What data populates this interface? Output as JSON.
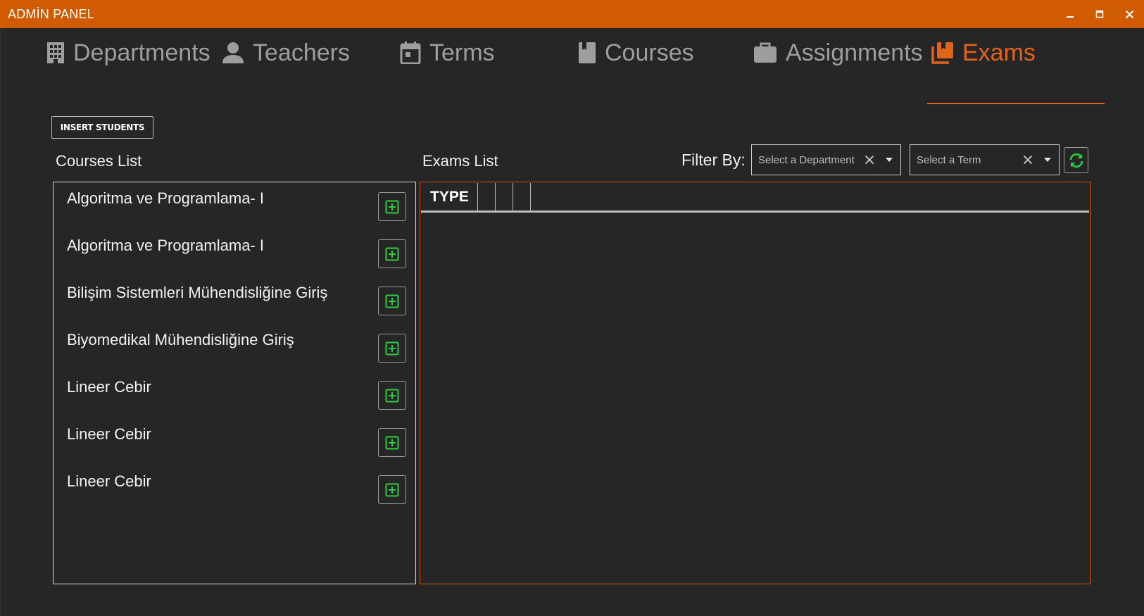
{
  "window": {
    "title": "ADMİN PANEL",
    "accent_color": "#d05b03",
    "controls": [
      "minimize-icon",
      "maximize-icon",
      "close-icon"
    ]
  },
  "tabs": [
    {
      "label": "Departments",
      "icon": "building-icon",
      "active": false
    },
    {
      "label": "Teachers",
      "icon": "person-icon",
      "active": false
    },
    {
      "label": "Terms",
      "icon": "calendar-icon",
      "active": false
    },
    {
      "label": "Courses",
      "icon": "book-icon",
      "active": false
    },
    {
      "label": "Assignments",
      "icon": "briefcase-icon",
      "active": false
    },
    {
      "label": "Exams",
      "icon": "library-icon",
      "active": true
    }
  ],
  "toolbar": {
    "insert_students_label": "INSERT STUDENTS"
  },
  "courses": {
    "heading": "Courses List",
    "items": [
      {
        "name": "Algoritma ve Programlama- I"
      },
      {
        "name": "Algoritma ve Programlama- I"
      },
      {
        "name": "Bilişim Sistemleri Mühendisliğine Giriş"
      },
      {
        "name": "Biyomedikal Mühendisliğine Giriş"
      },
      {
        "name": "Lineer Cebir"
      },
      {
        "name": "Lineer Cebir"
      },
      {
        "name": "Lineer Cebir"
      }
    ],
    "add_icon": "plus-square-icon",
    "add_icon_color": "#2ecc40"
  },
  "exams": {
    "heading": "Exams List",
    "filter_label": "Filter By:",
    "department_placeholder": "Select a Department",
    "term_placeholder": "Select a Term",
    "columns": [
      "TYPE",
      "",
      "",
      ""
    ],
    "border_color": "#c9581c",
    "refresh_icon": "refresh-icon",
    "refresh_color": "#2ecc40"
  }
}
